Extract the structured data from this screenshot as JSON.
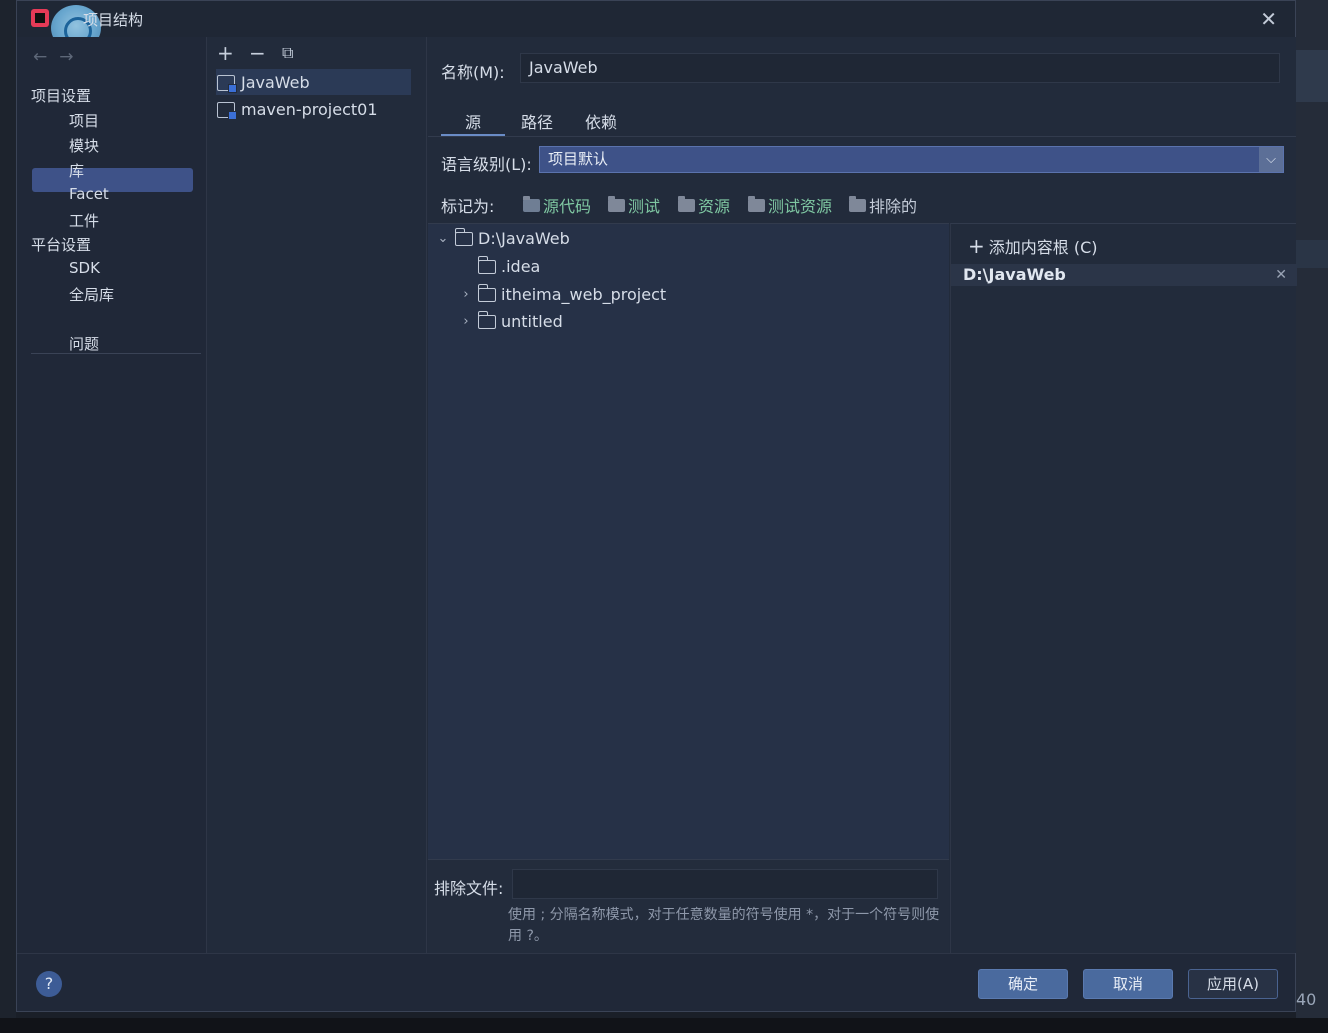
{
  "window": {
    "title": "项目结构"
  },
  "left_nav": {
    "sections": [
      {
        "label": "项目设置"
      },
      {
        "label": "平台设置"
      }
    ],
    "project_items": [
      "项目",
      "模块",
      "库",
      "Facet",
      "工件"
    ],
    "platform_items": [
      "SDK",
      "全局库"
    ],
    "problems": "问题",
    "selected": "模块"
  },
  "modules": {
    "items": [
      "JavaWeb",
      "maven-project01"
    ],
    "selected": "JavaWeb"
  },
  "details": {
    "name_label": "名称(M):",
    "name_value": "JavaWeb",
    "tabs": [
      "源",
      "路径",
      "依赖"
    ],
    "active_tab": "源",
    "lang_label": "语言级别(L):",
    "lang_value": "项目默认",
    "mark_label": "标记为:",
    "mark_buttons": [
      "源代码",
      "测试",
      "资源",
      "测试资源",
      "排除的"
    ]
  },
  "tree": {
    "root": "D:\\JavaWeb",
    "children": [
      ".idea",
      "itheima_web_project",
      "untitled"
    ]
  },
  "content_roots": {
    "add_label": "添加内容根 (C)",
    "roots": [
      "D:\\JavaWeb"
    ]
  },
  "exclude": {
    "label": "排除文件:",
    "value": "",
    "help": "使用 ; 分隔名称模式，对于任意数量的符号使用 *，对于一个符号则使用 ?。"
  },
  "footer": {
    "ok": "确定",
    "cancel": "取消",
    "apply": "应用(A)"
  },
  "outer": {
    "number": "40"
  },
  "colors": {
    "accent": "#3e5288",
    "background": "#222b3b",
    "mark_text": "#7fc7a2"
  }
}
